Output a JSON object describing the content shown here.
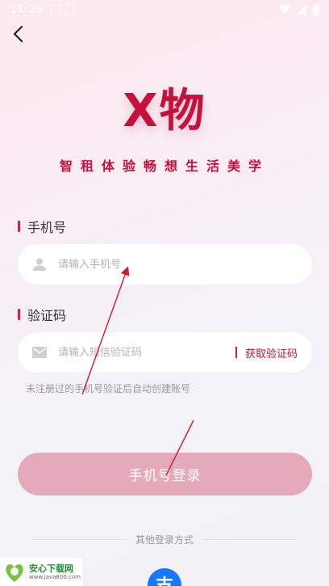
{
  "status_bar": {
    "time": "11:29"
  },
  "logo": {
    "text": "X物"
  },
  "slogan": "智租体验畅想生活美学",
  "phone": {
    "label": "手机号",
    "placeholder": "请输入手机号"
  },
  "code": {
    "label": "验证码",
    "placeholder": "请输入短信验证码",
    "get_code": "获取验证码"
  },
  "hint": "未注册过的手机号验证后自动创建账号",
  "login_button": "手机号登录",
  "other_login": "其他登录方式",
  "alipay_icon_char": "支",
  "watermark": {
    "title": "安心下载网",
    "url": "www.java800.com"
  },
  "colors": {
    "brand": "#c8103c",
    "accent_bar": "#d81e4b",
    "login_button": "#e5aab9",
    "alipay": "#1677ff"
  },
  "icons": [
    "back-arrow-icon",
    "user-icon",
    "mail-icon",
    "alipay-icon",
    "wifi-icon",
    "battery-icon",
    "signal-icon"
  ]
}
